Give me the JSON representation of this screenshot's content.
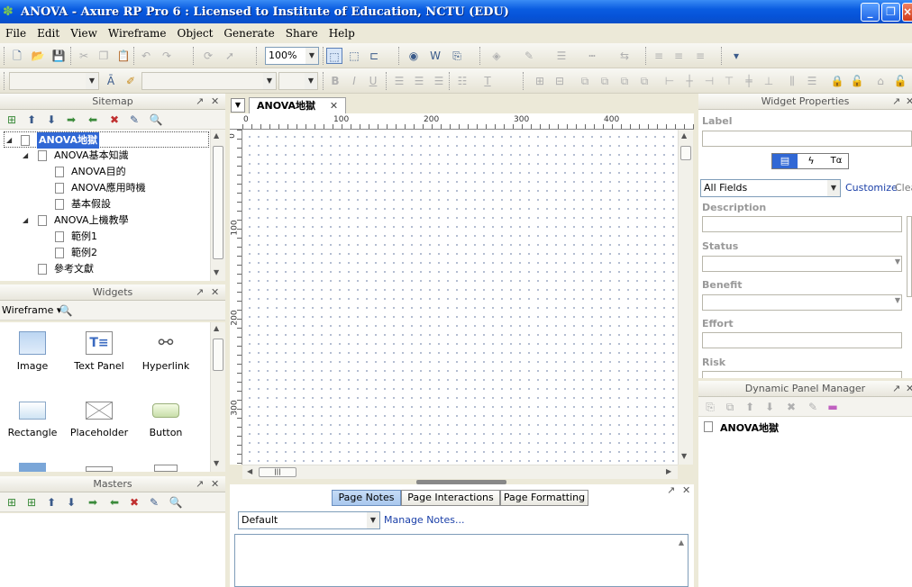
{
  "window": {
    "title": "ANOVA - Axure RP Pro 6 : Licensed to Institute of Education, NCTU (EDU)"
  },
  "menu": [
    "File",
    "Edit",
    "View",
    "Wireframe",
    "Object",
    "Generate",
    "Share",
    "Help"
  ],
  "toolbar": {
    "zoom": "100%"
  },
  "sitemap": {
    "title": "Sitemap",
    "items": [
      {
        "label": "ANOVA地獄",
        "depth": 0,
        "expanded": true,
        "selected": true
      },
      {
        "label": "ANOVA基本知識",
        "depth": 1,
        "expanded": true
      },
      {
        "label": "ANOVA目的",
        "depth": 2
      },
      {
        "label": "ANOVA應用時機",
        "depth": 2
      },
      {
        "label": "基本假設",
        "depth": 2
      },
      {
        "label": "ANOVA上機教學",
        "depth": 1,
        "expanded": true
      },
      {
        "label": "範例1",
        "depth": 2
      },
      {
        "label": "範例2",
        "depth": 2
      },
      {
        "label": "參考文獻",
        "depth": 1
      }
    ]
  },
  "widgets": {
    "title": "Widgets",
    "library": "Wireframe",
    "items": [
      "Image",
      "Text Panel",
      "Hyperlink",
      "Rectangle",
      "Placeholder",
      "Button"
    ]
  },
  "masters": {
    "title": "Masters"
  },
  "canvas": {
    "tab": "ANOVA地獄",
    "ruler_h": [
      "0",
      "100",
      "200",
      "300",
      "400"
    ],
    "ruler_v": [
      "0",
      "100",
      "200",
      "300"
    ]
  },
  "notes": {
    "tabs": [
      "Page Notes",
      "Page Interactions",
      "Page Formatting"
    ],
    "active_tab": "Page Notes",
    "notes_select": "Default",
    "manage_link": "Manage Notes..."
  },
  "widget_properties": {
    "title": "Widget Properties",
    "label": "Label",
    "fields_select": "All Fields",
    "customize": "Customize",
    "clear": "Clea",
    "fields": [
      "Description",
      "Status",
      "Benefit",
      "Effort",
      "Risk"
    ]
  },
  "dynamic_panel_manager": {
    "title": "Dynamic Panel Manager",
    "page": "ANOVA地獄"
  }
}
